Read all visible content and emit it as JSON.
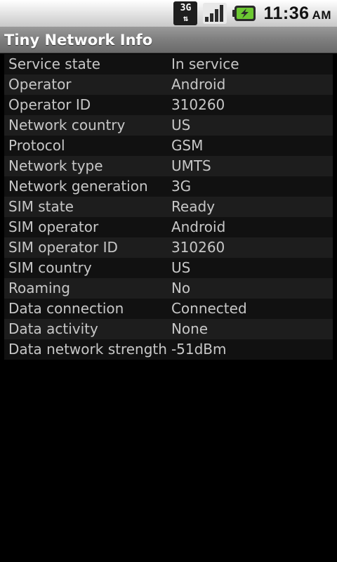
{
  "status_bar": {
    "network_type": "3G",
    "network_arrows": "⇅",
    "time": "11:36",
    "ampm": "AM",
    "colors": {
      "battery": "#6cc832",
      "signal": "#2a2a2a"
    }
  },
  "app": {
    "title": "Tiny Network Info"
  },
  "rows": [
    {
      "label": "Service state",
      "value": "In service"
    },
    {
      "label": "Operator",
      "value": "Android"
    },
    {
      "label": "Operator ID",
      "value": "310260"
    },
    {
      "label": "Network country",
      "value": "US"
    },
    {
      "label": "Protocol",
      "value": "GSM"
    },
    {
      "label": "Network type",
      "value": "UMTS"
    },
    {
      "label": "Network generation",
      "value": "3G"
    },
    {
      "label": "SIM state",
      "value": "Ready"
    },
    {
      "label": "SIM operator",
      "value": "Android"
    },
    {
      "label": "SIM operator ID",
      "value": "310260"
    },
    {
      "label": "SIM country",
      "value": "US"
    },
    {
      "label": "Roaming",
      "value": "No"
    },
    {
      "label": "Data connection",
      "value": "Connected"
    },
    {
      "label": "Data activity",
      "value": "None"
    },
    {
      "label": "Data network strength",
      "value": "-51dBm"
    }
  ]
}
